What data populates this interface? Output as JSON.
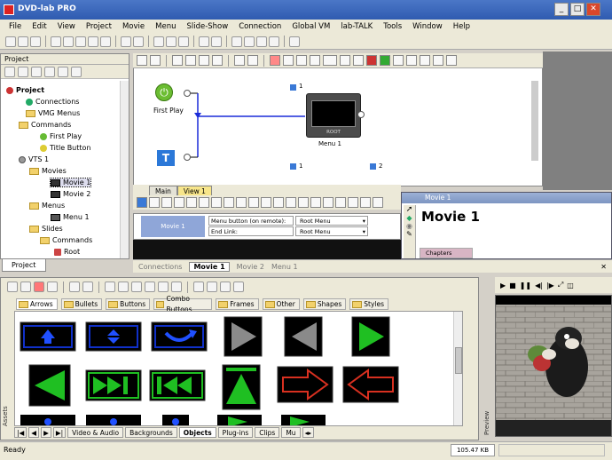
{
  "window": {
    "title": "DVD-lab PRO"
  },
  "menu": [
    "File",
    "Edit",
    "View",
    "Project",
    "Movie",
    "Menu",
    "Slide-Show",
    "Connection",
    "Global VM",
    "lab-TALK",
    "Tools",
    "Window",
    "Help"
  ],
  "project_panel": {
    "header": "Project",
    "tab": "Project",
    "tree": [
      {
        "label": "Project",
        "icon": "project-icon"
      },
      {
        "label": "Connections",
        "icon": "connections-icon"
      },
      {
        "label": "VMG Menus",
        "icon": "folder-icon"
      },
      {
        "label": "Commands",
        "icon": "folder-icon"
      },
      {
        "label": "First Play",
        "icon": "first-play-icon"
      },
      {
        "label": "Title Button",
        "icon": "title-button-icon"
      },
      {
        "label": "VTS 1",
        "icon": "vts-icon"
      },
      {
        "label": "Movies",
        "icon": "folder-icon"
      },
      {
        "label": "Movie 1",
        "icon": "movie-icon"
      },
      {
        "label": "Movie 2",
        "icon": "movie-icon"
      },
      {
        "label": "Menus",
        "icon": "folder-icon"
      },
      {
        "label": "Menu 1",
        "icon": "menu-icon"
      },
      {
        "label": "Slides",
        "icon": "folder-icon"
      },
      {
        "label": "Commands",
        "icon": "folder-icon"
      },
      {
        "label": "Root",
        "icon": "root-icon"
      }
    ]
  },
  "connections": {
    "first_play": "First Play",
    "menu_node_label": "Menu 1",
    "menu_root_tag": "ROOT",
    "badge_top": "1",
    "badge_bottom_left": "1",
    "badge_bottom_right": "2"
  },
  "view_tabs": [
    "Main",
    "View 1"
  ],
  "link_table": {
    "button_name": "Movie 1",
    "rows": [
      {
        "label": "Menu button (on remote):",
        "value": "Root Menu"
      },
      {
        "label": "End Link:",
        "value": "Root Menu"
      }
    ]
  },
  "movie_window": {
    "titlebar": "Movie 1",
    "heading": "Movie 1",
    "chapters_label": "Chapters"
  },
  "doc_tabs": [
    "Connections",
    "Movie 1",
    "Movie 2",
    "Menu 1"
  ],
  "objects": {
    "categories": [
      "Arrows",
      "Bullets",
      "Buttons",
      "Combo Buttons",
      "Frames",
      "Other",
      "Shapes",
      "Styles"
    ],
    "bottom_tabs": [
      "Video & Audio",
      "Backgrounds",
      "Objects",
      "Plug-ins",
      "Clips",
      "Mu"
    ],
    "side_label": "Assets"
  },
  "preview": {
    "side_label": "Preview"
  },
  "status": {
    "text": "Ready",
    "size": "105.47 KB"
  },
  "colors": {
    "accent": "#2f5bb0",
    "tab_active": "#f7e58a",
    "green": "#1fbf22",
    "blue": "#1030c8"
  }
}
